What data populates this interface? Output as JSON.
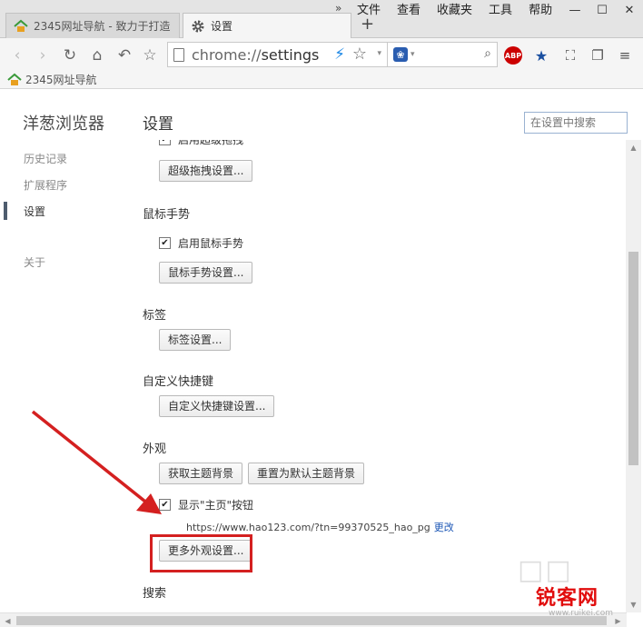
{
  "tabs": [
    {
      "title": "2345网址导航 - 致力于打造",
      "favicon": "house-icon",
      "active": false
    },
    {
      "title": "设置",
      "favicon": "gear-icon",
      "active": true
    }
  ],
  "tab_overflow": "»",
  "new_tab": "+",
  "menu": [
    "文件",
    "查看",
    "收藏夹",
    "工具",
    "帮助"
  ],
  "window_controls": {
    "min": "—",
    "max": "☐",
    "close": "✕"
  },
  "toolbar": {
    "url_scheme": "chrome://",
    "url_path": "settings",
    "search_engine_icon": "baidu-paw-icon",
    "extensions": [
      "ABP"
    ]
  },
  "bookmarks": [
    {
      "label": "2345网址导航",
      "favicon": "house-icon"
    }
  ],
  "sidebar": {
    "brand": "洋葱浏览器",
    "items": [
      {
        "label": "历史记录",
        "active": false
      },
      {
        "label": "扩展程序",
        "active": false
      },
      {
        "label": "设置",
        "active": true
      },
      {
        "label": "关于",
        "active": false
      }
    ]
  },
  "main": {
    "title": "设置",
    "search_placeholder": "在设置中搜索",
    "cut_off_checkbox": "启用超级拖拽",
    "drag_button": "超级拖拽设置...",
    "gesture": {
      "title": "鼠标手势",
      "checkbox": "启用鼠标手势",
      "button": "鼠标手势设置..."
    },
    "tabs_section": {
      "title": "标签",
      "button": "标签设置..."
    },
    "shortcuts": {
      "title": "自定义快捷键",
      "button": "自定义快捷键设置..."
    },
    "appearance": {
      "title": "外观",
      "get_theme": "获取主题背景",
      "reset_theme": "重置为默认主题背景",
      "home_checkbox": "显示\"主页\"按钮",
      "home_url": "https://www.hao123.com/?tn=99370525_hao_pg",
      "change_link": "更改",
      "more_button": "更多外观设置..."
    },
    "search_section": {
      "title": "搜索"
    }
  },
  "watermark": {
    "brand": "锐客网",
    "url": "www.ruikei.com"
  },
  "colors": {
    "highlight": "#d42020",
    "link": "#1a55b5",
    "accent": "#4e5c6e"
  }
}
